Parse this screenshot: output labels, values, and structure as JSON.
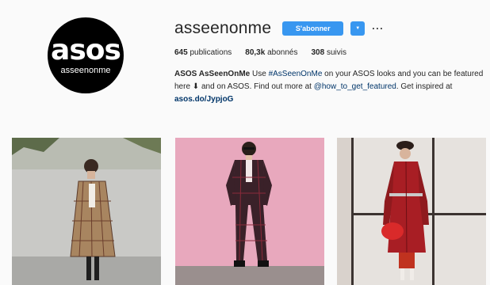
{
  "profile": {
    "avatar_brand": "asos",
    "avatar_sub": "asseenonme",
    "username": "asseenonme",
    "follow_label": "S'abonner",
    "dropdown_glyph": "▼",
    "more_glyph": "···"
  },
  "stats": [
    {
      "value": "645",
      "label": "publications"
    },
    {
      "value": "80,3k",
      "label": "abonnés"
    },
    {
      "value": "308",
      "label": "suivis"
    }
  ],
  "bio": {
    "name": "ASOS AsSeenOnMe",
    "text1": " Use ",
    "hashtag": "#AsSeenOnMe",
    "text2": " on your ASOS looks and you can be featured here ",
    "arrow": "⬇",
    "text3": " and on ASOS. Find out more at ",
    "mention": "@how_to_get_featured",
    "text4": ". Get inspired at",
    "link": "asos.do/JypjoG"
  },
  "colors": {
    "accent": "#3897f0",
    "link": "#003569",
    "background": "#fafafa"
  },
  "icons": [
    "dropdown-icon",
    "more-options-icon",
    "down-arrow-icon"
  ]
}
